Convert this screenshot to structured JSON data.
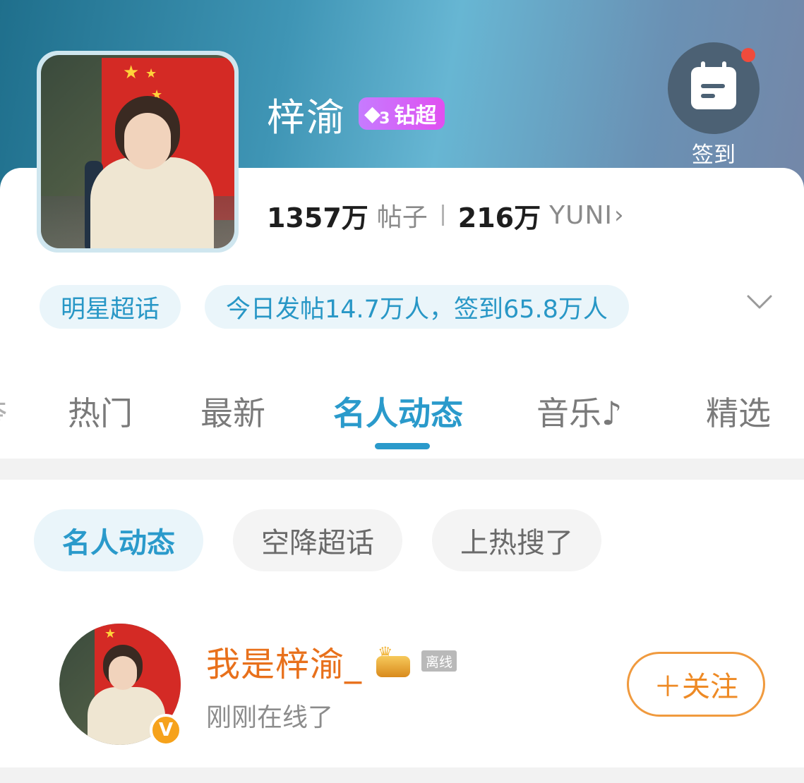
{
  "header": {
    "title": "梓渝",
    "badge": {
      "gem": "◆",
      "level": "3",
      "label": "钻超"
    },
    "signin_label": "签到",
    "colors": {
      "accent": "#2a9acb",
      "badge": "#d65df2",
      "notify_dot": "#f04b3c"
    }
  },
  "stats": {
    "posts_count": "1357万",
    "posts_label": "帖子",
    "fans_count": "216万",
    "fans_label": "YUNI",
    "chevron": "›"
  },
  "chips": [
    {
      "label": "明星超话"
    },
    {
      "label": "今日发帖14.7万人，签到65.8万人"
    }
  ],
  "tabs": {
    "edge_fragment": "夸",
    "items": [
      {
        "label": "热门"
      },
      {
        "label": "最新"
      },
      {
        "label": "名人动态",
        "active": true
      },
      {
        "label": "音乐♪"
      },
      {
        "label": "精选"
      }
    ]
  },
  "subtabs": [
    {
      "label": "名人动态",
      "active": true
    },
    {
      "label": "空降超话"
    },
    {
      "label": "上热搜了"
    }
  ],
  "post": {
    "name": "我是梓渝_",
    "status_tag": "离线",
    "subtitle": "刚刚在线了",
    "vip_badge": "V",
    "follow_label": "＋关注"
  }
}
